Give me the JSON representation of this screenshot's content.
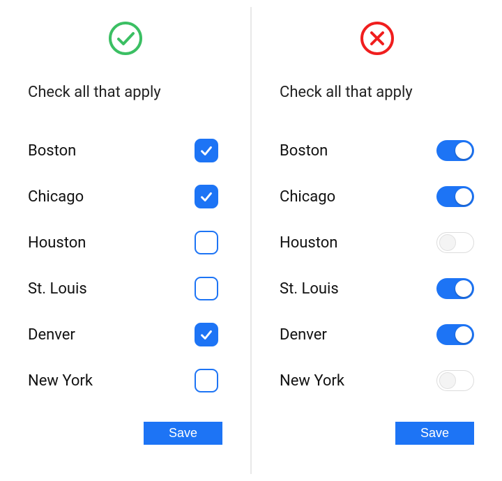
{
  "accent_color": "#1d74f5",
  "ok_color": "#3bbf63",
  "err_color": "#f01e1e",
  "good": {
    "heading": "Check all that apply",
    "save_label": "Save",
    "items": [
      {
        "label": "Boston",
        "checked": true
      },
      {
        "label": "Chicago",
        "checked": true
      },
      {
        "label": "Houston",
        "checked": false
      },
      {
        "label": "St. Louis",
        "checked": false
      },
      {
        "label": "Denver",
        "checked": true
      },
      {
        "label": "New York",
        "checked": false
      }
    ]
  },
  "bad": {
    "heading": "Check all that apply",
    "save_label": "Save",
    "items": [
      {
        "label": "Boston",
        "on": true
      },
      {
        "label": "Chicago",
        "on": true
      },
      {
        "label": "Houston",
        "on": false
      },
      {
        "label": "St. Louis",
        "on": true
      },
      {
        "label": "Denver",
        "on": true
      },
      {
        "label": "New York",
        "on": false
      }
    ]
  }
}
